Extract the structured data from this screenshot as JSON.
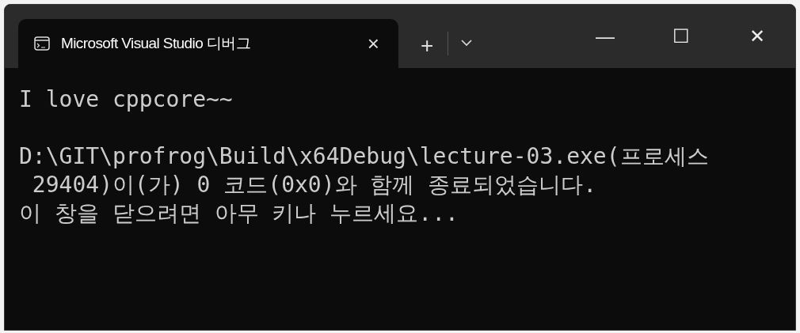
{
  "window": {
    "tabs": [
      {
        "title": "Microsoft Visual Studio 디버그",
        "selected": true,
        "close": "×"
      }
    ],
    "new_tab": "+",
    "controls": {
      "minimize": "—",
      "maximize": "☐",
      "close": "✕"
    }
  },
  "console": {
    "blocks": [
      {
        "lines": [
          "I love cppcore~~"
        ]
      },
      {
        "lines": [
          "D:\\GIT\\profrog\\Build\\x64Debug\\lecture-03.exe(프로세스",
          " 29404)이(가) 0 코드(0x0)와 함께 종료되었습니다.",
          "이 창을 닫으려면 아무 키나 누르세요..."
        ]
      }
    ]
  }
}
